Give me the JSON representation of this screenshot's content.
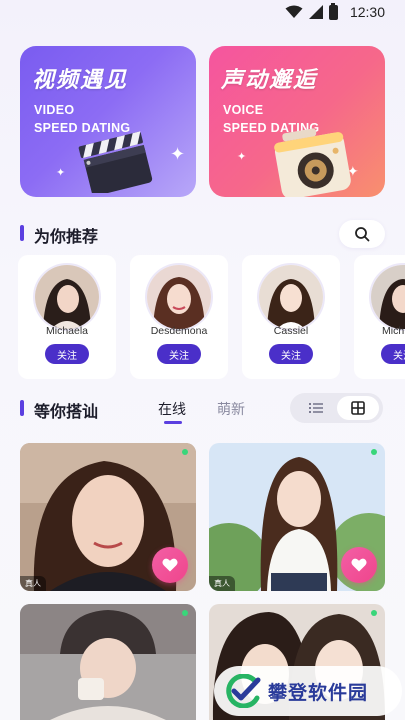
{
  "status_bar": {
    "time": "12:30"
  },
  "feature_cards": [
    {
      "title": "视频遇见",
      "subtitle": "VIDEO\nSPEED DATING"
    },
    {
      "title": "声动邂逅",
      "subtitle": "VOICE\nSPEED DATING"
    }
  ],
  "recommend": {
    "title": "为你推荐",
    "users": [
      {
        "name": "Michaela",
        "follow_label": "关注"
      },
      {
        "name": "Desdemona",
        "follow_label": "关注"
      },
      {
        "name": "Cassiel",
        "follow_label": "关注"
      },
      {
        "name": "Mich",
        "follow_label": "关注"
      }
    ]
  },
  "waiting": {
    "title": "等你搭讪",
    "tabs": [
      {
        "label": "在线",
        "active": true
      },
      {
        "label": "萌新",
        "active": false
      }
    ],
    "view_mode": "grid",
    "cards": [
      {
        "badge": "真人",
        "online": true
      },
      {
        "badge": "真人",
        "online": true
      },
      {
        "badge": "",
        "online": true
      },
      {
        "badge": "",
        "online": true
      }
    ]
  },
  "watermark": {
    "text": "攀登软件园"
  },
  "colors": {
    "accent": "#5b3fe0",
    "follow": "#4a2fc9",
    "like": "#f0458c",
    "online": "#39d67a"
  }
}
